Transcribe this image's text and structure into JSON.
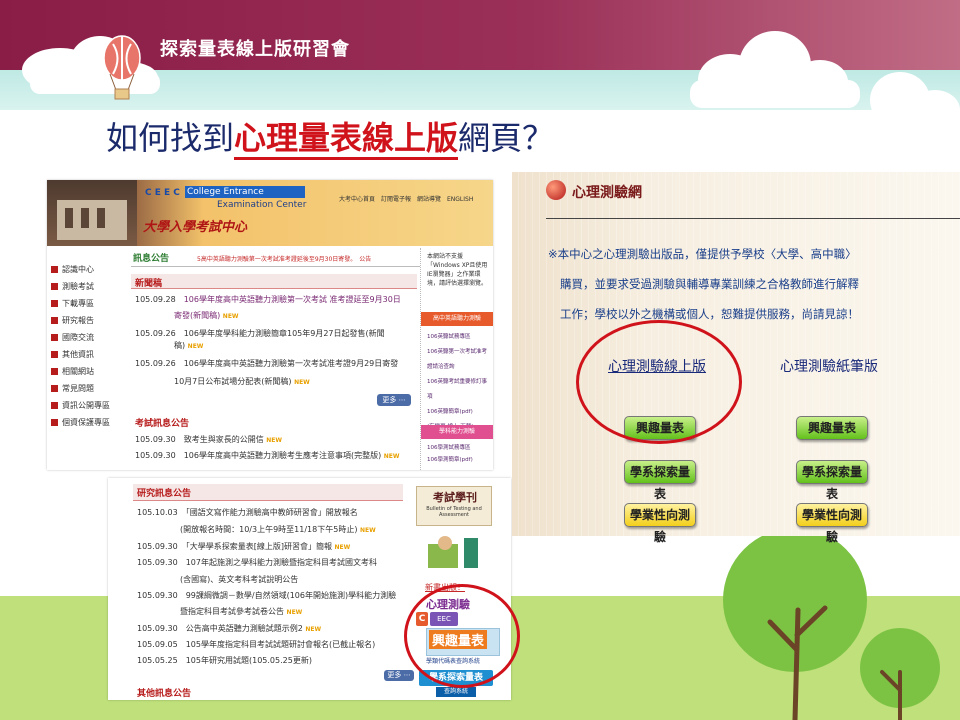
{
  "slide": {
    "header_title": "探索量表線上版研習會",
    "heading_prefix": "如何找到",
    "heading_highlight": "心理量表線上版",
    "heading_suffix": "網頁？"
  },
  "ceec_site": {
    "brand_code": "C E E C",
    "brand_en_line1": "College Entrance",
    "brand_en_line2": "Examination Center",
    "brand_zh": "大學入學考試中心",
    "top_links": "大考中心首頁　訂閱電子報　網站導覽　ENGLISH",
    "news_label": "訊息公告",
    "marquee": "5高中英語聽力測驗第一次考試准考證延後至9月30日寄發。　公告",
    "sidebar": [
      "認識中心",
      "測驗考試",
      "下載專區",
      "研究報告",
      "國際交流",
      "其他資訊",
      "相關網站",
      "常見問題",
      "資訊公開專區",
      "個資保護專區"
    ],
    "latest_title": "新聞稿",
    "latest_rows": [
      {
        "date": "105.09.28",
        "text": "106學年度高中英語聽力測驗第一次考試 准考證延至9月30日"
      },
      {
        "date": "",
        "text": "寄發(新聞稿)"
      },
      {
        "date": "105.09.26",
        "text": "106學年度學科能力測驗簡章105年9月27日起發售(新聞"
      },
      {
        "date": "",
        "text": "稿)"
      },
      {
        "date": "105.09.26",
        "text": "106學年度高中英語聽力測驗第一次考試准考證9月29日寄發"
      },
      {
        "date": "",
        "text": "10月7日公布試場分配表(新聞稿)"
      }
    ],
    "exam_title": "考試訊息公告",
    "exam_rows": [
      {
        "date": "105.09.30",
        "text": "致考生與家長的公開信"
      },
      {
        "date": "105.09.30",
        "text": "106學年度高中英語聽力測驗考生應考注意事項(完整版)"
      }
    ],
    "more_label": "更多 ⋯",
    "right_notice": "本網站不支援「Windows XP且使用IE瀏覽器」之作業環境，請評估選擇瀏覽。",
    "right_section_1": "高中英語聽力測驗",
    "right_links_1": [
      "106英聽試務專區",
      "106英聽第一次考試准考證請洽查詢",
      "106英聽考試重要修訂事項",
      "106英聽簡章(pdf)",
      "(有變更:線上 下載)"
    ],
    "right_section_2": "學科能力測驗",
    "right_links_2": [
      "106學測試務專區",
      "106學測簡章(pdf)"
    ],
    "research_title": "研究訊息公告",
    "research_rows": [
      {
        "date": "105.10.03",
        "text": "「國語文寫作能力測驗高中教師研習會」開放報名"
      },
      {
        "date": "",
        "text": "(開放報名時間：10/3上午9時至11/18下午5時止)"
      },
      {
        "date": "105.09.30",
        "text": "「大學學系探索量表[線上版]研習會」簡報"
      },
      {
        "date": "105.09.30",
        "text": "107年起施測之學科能力測驗暨指定科目考試國文考科"
      },
      {
        "date": "",
        "text": "(含國寫)、英文考科考試說明公告"
      },
      {
        "date": "105.09.30",
        "text": "99課綱微調－數學/自然領域(106年開始施測)學科能力測驗"
      },
      {
        "date": "",
        "text": "暨指定科目考試參考試卷公告"
      },
      {
        "date": "105.09.30",
        "text": "公告高中英語聽力測驗試題示例2"
      },
      {
        "date": "105.09.05",
        "text": "105學年度指定科目考試試題研討會報名(已截止報名)"
      },
      {
        "date": "105.05.25",
        "text": "105年研究用試題(105.05.25更新)"
      }
    ],
    "other_title": "其他訊息公告",
    "journal_title": "考試學刊",
    "journal_sub": "Bulletin of Testing and Assessment",
    "psych_new": "新書出版！",
    "psych_label": "心理測驗",
    "interest_label": "興趣量表",
    "interest_sub": "學類代碼表查詢系統",
    "explore_label": "學系探索量表",
    "explore_sub": "查詢系統",
    "new_badge": "NEW",
    "new_badge_n": "NEW",
    "logo_main": "C",
    "logo_sub": "EEC"
  },
  "psych_page": {
    "title": "心理測驗網",
    "notice_line1": "※本中心之心理測驗出版品，僅提供予學校〈大學、高中職〉",
    "notice_line2": "購買，並要求受過測驗與輔導專業訓練之合格教師進行解釋",
    "notice_line3": "工作；學校以外之機構或個人，恕難提供服務，尚請見諒！",
    "online_link": "心理測驗線上版",
    "paper_link": "心理測驗紙筆版",
    "online_buttons": [
      "興趣量表",
      "學系探索量表",
      "學業性向測驗"
    ],
    "paper_buttons": [
      "興趣量表",
      "學系探索量表",
      "學業性向測驗"
    ]
  }
}
